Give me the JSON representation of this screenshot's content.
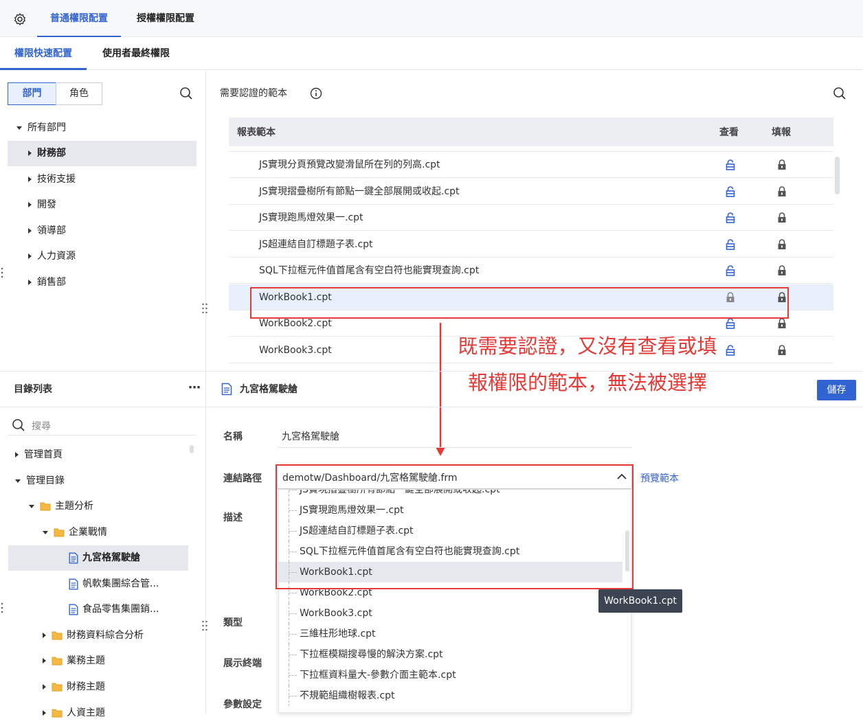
{
  "top_tabs": [
    "普通權限配置",
    "授權權限配置"
  ],
  "sub_tabs": [
    "權限快速配置",
    "使用者最終權限"
  ],
  "left_panel": {
    "segments": [
      "部門",
      "角色"
    ],
    "tree_root": "所有部門",
    "departments": [
      "財務部",
      "技術支援",
      "開發",
      "領導部",
      "人力資源",
      "銷售部"
    ]
  },
  "right_panel": {
    "title": "需要認證的範本",
    "columns": [
      "報表範本",
      "查看",
      "填報"
    ],
    "rows": [
      {
        "name": "JS實現分頁預覽改變滑鼠所在列的列高.cpt",
        "view": "unlocked",
        "fill": "locked"
      },
      {
        "name": "JS實現摺疊樹所有節點一鍵全部展開或收起.cpt",
        "view": "unlocked",
        "fill": "locked"
      },
      {
        "name": "JS實現跑馬燈效果一.cpt",
        "view": "unlocked",
        "fill": "locked"
      },
      {
        "name": "JS超連結自訂標題子表.cpt",
        "view": "unlocked",
        "fill": "locked"
      },
      {
        "name": "SQL下拉框元件值首尾含有空白符也能實現查詢.cpt",
        "view": "unlocked",
        "fill": "locked"
      },
      {
        "name": "WorkBook1.cpt",
        "view": "locked",
        "fill": "locked"
      },
      {
        "name": "WorkBook2.cpt",
        "view": "unlocked",
        "fill": "locked"
      },
      {
        "name": "WorkBook3.cpt",
        "view": "unlocked",
        "fill": "locked"
      }
    ]
  },
  "annotation": "既需要認證，又沒有查看或填報權限的範本，無法被選擇",
  "catalog": {
    "title": "目錄列表",
    "more": "⋯",
    "search_placeholder": "搜尋",
    "items": [
      {
        "label": "管理首頁",
        "type": "collapsed"
      },
      {
        "label": "管理目錄",
        "type": "expanded"
      },
      {
        "label": "主題分析",
        "type": "folder-open"
      },
      {
        "label": "企業戰情",
        "type": "folder-open"
      },
      {
        "label": "九宮格駕駛艙",
        "type": "file",
        "selected": true
      },
      {
        "label": "帆軟集團綜合管...",
        "type": "file"
      },
      {
        "label": "食品零售集團銷...",
        "type": "file"
      },
      {
        "label": "財務資料綜合分析",
        "type": "folder"
      },
      {
        "label": "業務主題",
        "type": "folder"
      },
      {
        "label": "財務主題",
        "type": "folder"
      },
      {
        "label": "人資主題",
        "type": "folder"
      }
    ]
  },
  "detail": {
    "title": "九宮格駕駛艙",
    "save_label": "儲存",
    "name_label": "名稱",
    "name_value": "九宮格駕駛艙",
    "path_label": "連結路徑",
    "path_value": "demotw/Dashboard/九宮格駕駛艙.frm",
    "preview_label": "預覽範本",
    "desc_label": "描述",
    "type_label": "類型",
    "terminal_label": "展示終端",
    "param_label": "參數設定",
    "tooltip": "WorkBook1.cpt"
  },
  "dropdown_items": [
    "JS實現摺疊樹所有節點一鍵全部展開或收起.cpt",
    "JS實現跑馬燈效果一.cpt",
    "JS超連結自訂標題子表.cpt",
    "SQL下拉框元件值首尾含有空白符也能實現查詢.cpt",
    "WorkBook1.cpt",
    "WorkBook2.cpt",
    "WorkBook3.cpt",
    "三維柱形地球.cpt",
    "下拉框模糊搜尋慢的解決方案.cpt",
    "下拉框資料量大-參數介面主範本.cpt",
    "不規範組織樹報表.cpt"
  ],
  "colors": {
    "accent": "#3264d1",
    "annotation": "#e53935",
    "tooltip_bg": "#3d4452"
  }
}
